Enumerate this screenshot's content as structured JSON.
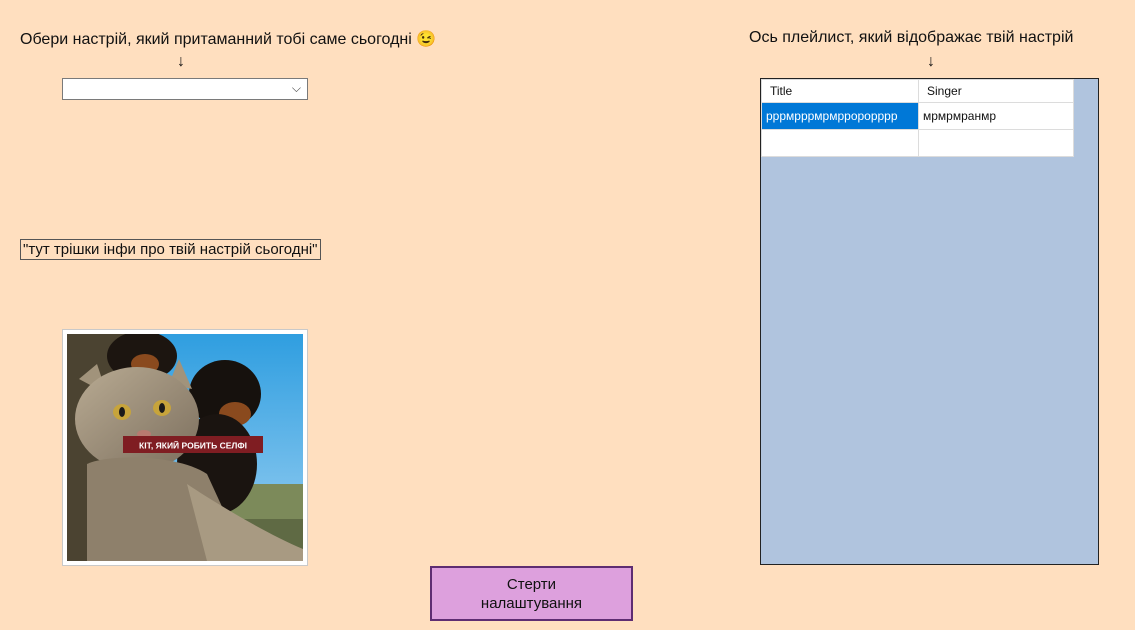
{
  "mood": {
    "prompt": "Обери настрій, який притаманний тобі саме сьогодні 😉",
    "arrow": "↓",
    "select_value": "",
    "chevron": "⌵",
    "info": "\"тут трішки інфи про твій настрій сьогодні\"",
    "image_caption": "КІТ, ЯКИЙ РОБИТЬ СЕЛФІ"
  },
  "playlist": {
    "prompt": "Ось плейлист, який відображає твій настрій",
    "arrow": "↓",
    "columns": [
      "Title",
      "Singer"
    ],
    "rows": [
      {
        "title": "рррмрррмрмрророрррр",
        "singer": "мрмрмранмр"
      },
      {
        "title": "",
        "singer": ""
      }
    ]
  },
  "reset_button": {
    "line1": "Стерти",
    "line2": "налаштування"
  },
  "colors": {
    "background": "#ffdfbf",
    "grid_background": "#b0c4de",
    "selection": "#0078d7",
    "button": "#dda0dd"
  }
}
